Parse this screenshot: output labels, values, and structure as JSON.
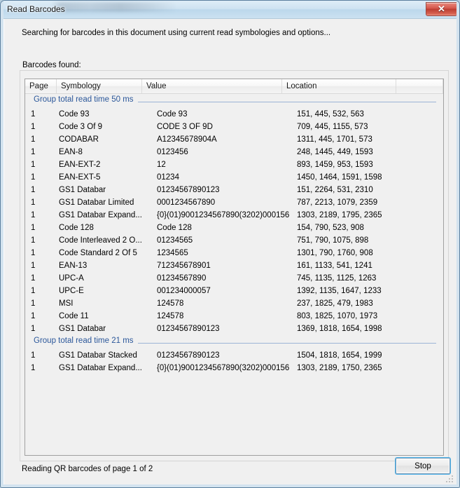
{
  "window": {
    "title": "Read Barcodes",
    "close_label": "✕"
  },
  "status": {
    "searching_text": "Searching for barcodes in this document using current read symbologies and options..."
  },
  "groupbox": {
    "label": "Barcodes found:"
  },
  "table": {
    "columns": [
      "Page",
      "Symbology",
      "Value",
      "Location",
      ""
    ],
    "groups": [
      {
        "header": "Group total read time 50 ms",
        "rows": [
          {
            "page": "1",
            "symbology": "Code 93",
            "value": "Code 93",
            "location": "151, 445, 532, 563"
          },
          {
            "page": "1",
            "symbology": "Code 3 Of 9",
            "value": "CODE 3 OF 9D",
            "location": "709, 445, 1155, 573"
          },
          {
            "page": "1",
            "symbology": "CODABAR",
            "value": "A12345678904A",
            "location": "1311, 445, 1701, 573"
          },
          {
            "page": "1",
            "symbology": "EAN-8",
            "value": "0123456",
            "location": "248, 1445, 449, 1593"
          },
          {
            "page": "1",
            "symbology": "EAN-EXT-2",
            "value": "12",
            "location": "893, 1459, 953, 1593"
          },
          {
            "page": "1",
            "symbology": "EAN-EXT-5",
            "value": "01234",
            "location": "1450, 1464, 1591, 1598"
          },
          {
            "page": "1",
            "symbology": "GS1 Databar",
            "value": "01234567890123",
            "location": "151, 2264, 531, 2310"
          },
          {
            "page": "1",
            "symbology": "GS1 Databar Limited",
            "value": "0001234567890",
            "location": "787, 2213, 1079, 2359"
          },
          {
            "page": "1",
            "symbology": "GS1 Databar Expand...",
            "value": "{0}(01)9001234567890(3202)000156",
            "location": "1303, 2189, 1795, 2365"
          },
          {
            "page": "1",
            "symbology": "Code 128",
            "value": "Code 128",
            "location": "154, 790, 523, 908"
          },
          {
            "page": "1",
            "symbology": "Code Interleaved 2 O...",
            "value": "01234565",
            "location": "751, 790, 1075, 898"
          },
          {
            "page": "1",
            "symbology": "Code Standard 2 Of 5",
            "value": "1234565",
            "location": "1301, 790, 1760, 908"
          },
          {
            "page": "1",
            "symbology": "EAN-13",
            "value": "712345678901",
            "location": "161, 1133, 541, 1241"
          },
          {
            "page": "1",
            "symbology": "UPC-A",
            "value": "01234567890",
            "location": "745, 1135, 1125, 1263"
          },
          {
            "page": "1",
            "symbology": "UPC-E",
            "value": "001234000057",
            "location": "1392, 1135, 1647, 1233"
          },
          {
            "page": "1",
            "symbology": "MSI",
            "value": "124578",
            "location": "237, 1825, 479, 1983"
          },
          {
            "page": "1",
            "symbology": "Code 11",
            "value": "124578",
            "location": "803, 1825, 1070, 1973"
          },
          {
            "page": "1",
            "symbology": "GS1 Databar",
            "value": "01234567890123",
            "location": "1369, 1818, 1654, 1998"
          }
        ]
      },
      {
        "header": "Group total read time 21 ms",
        "rows": [
          {
            "page": "1",
            "symbology": "GS1 Databar Stacked",
            "value": "01234567890123",
            "location": "1504, 1818, 1654, 1999"
          },
          {
            "page": "1",
            "symbology": "GS1 Databar Expand...",
            "value": "{0}(01)9001234567890(3202)000156",
            "location": "1303, 2189, 1750, 2365"
          }
        ]
      }
    ]
  },
  "footer": {
    "progress_text": "Reading QR barcodes of page 1 of 2",
    "stop_label": "Stop"
  },
  "colors": {
    "group_header": "#2b579a",
    "close_button": "#bb3d31",
    "focus_ring": "#49b0e8"
  }
}
